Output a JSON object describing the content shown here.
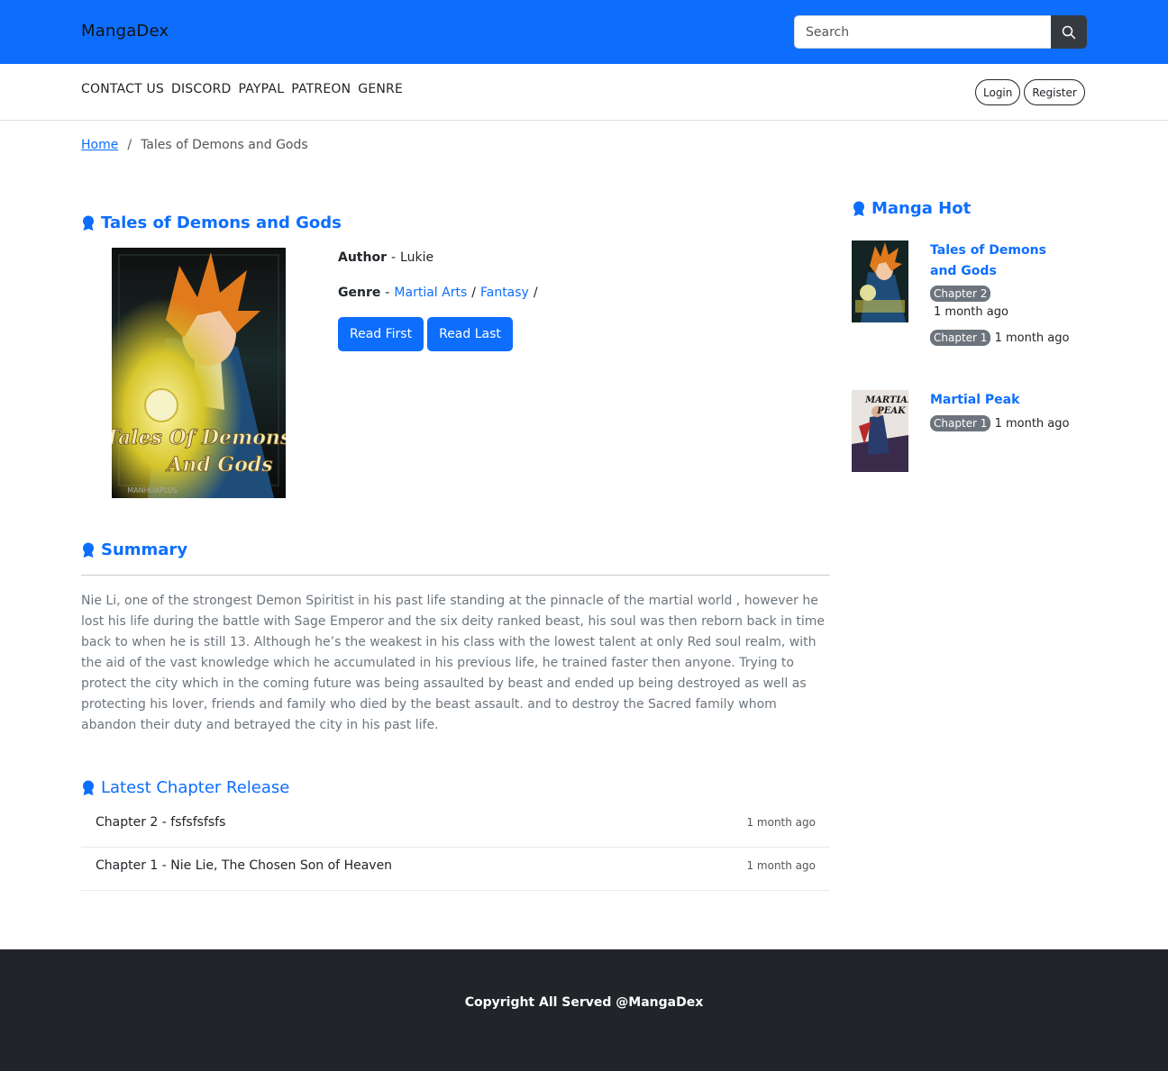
{
  "header": {
    "brand": "MangaDex",
    "search_placeholder": "Search"
  },
  "nav": {
    "links": [
      "CONTACT US",
      "DISCORD",
      "PAYPAL",
      "PATREON",
      "GENRE"
    ],
    "login_label": "Login",
    "register_label": "Register"
  },
  "breadcrumb": {
    "home": "Home",
    "separator": "/",
    "current": "Tales of Demons and Gods"
  },
  "manga": {
    "title": "Tales of Demons and Gods",
    "author_label": "Author",
    "author_value": "Lukie",
    "genre_label": "Genre",
    "genres": [
      "Martial Arts",
      "Fantasy"
    ],
    "dash": "-",
    "slash": "/",
    "read_first": "Read First",
    "read_last": "Read Last"
  },
  "summary": {
    "heading": "Summary",
    "text": "Nie Li, one of the strongest Demon Spiritist in his past life standing at the pinnacle of the martial world , however he lost his life during the battle with Sage Emperor and the six deity ranked beast, his soul was then reborn back in time back to when he is still 13. Although he’s the weakest in his class with the lowest talent at only Red soul realm, with the aid of the vast knowledge which he accumulated in his previous life, he trained faster then anyone. Trying to protect the city which in the coming future was being assaulted by beast and ended up being destroyed as well as protecting his lover, friends and family who died by the beast assault. and to destroy the Sacred family whom abandon their duty and betrayed the city in his past life."
  },
  "latest": {
    "heading": "Latest Chapter Release",
    "chapters": [
      {
        "title": "Chapter 2 - fsfsfsfsfs",
        "time": "1 month ago"
      },
      {
        "title": "Chapter 1 - Nie Lie, The Chosen Son of Heaven",
        "time": "1 month ago"
      }
    ]
  },
  "sidebar": {
    "heading": "Manga Hot",
    "items": [
      {
        "title": "Tales of Demons and Gods",
        "chapters": [
          {
            "label": "Chapter 2",
            "time": "1 month ago"
          },
          {
            "label": "Chapter 1",
            "time": "1 month ago"
          }
        ]
      },
      {
        "title": "Martial Peak",
        "chapters": [
          {
            "label": "Chapter 1",
            "time": "1 month ago"
          }
        ]
      }
    ]
  },
  "cover_art": {
    "main_caption_line1": "Tales Of Demons",
    "main_caption_line2": "And Gods",
    "main_watermark": "MANHUAPLUS",
    "side2_caption_line1": "MARTIAL",
    "side2_caption_line2": "PEAK"
  },
  "footer": {
    "copyright": "Copyright All Served @MangaDex"
  },
  "colors": {
    "primary": "#0d6efd",
    "dark": "#212529",
    "badge": "#6c757d"
  },
  "icons": {
    "search": "search-icon",
    "section": "award-icon"
  }
}
